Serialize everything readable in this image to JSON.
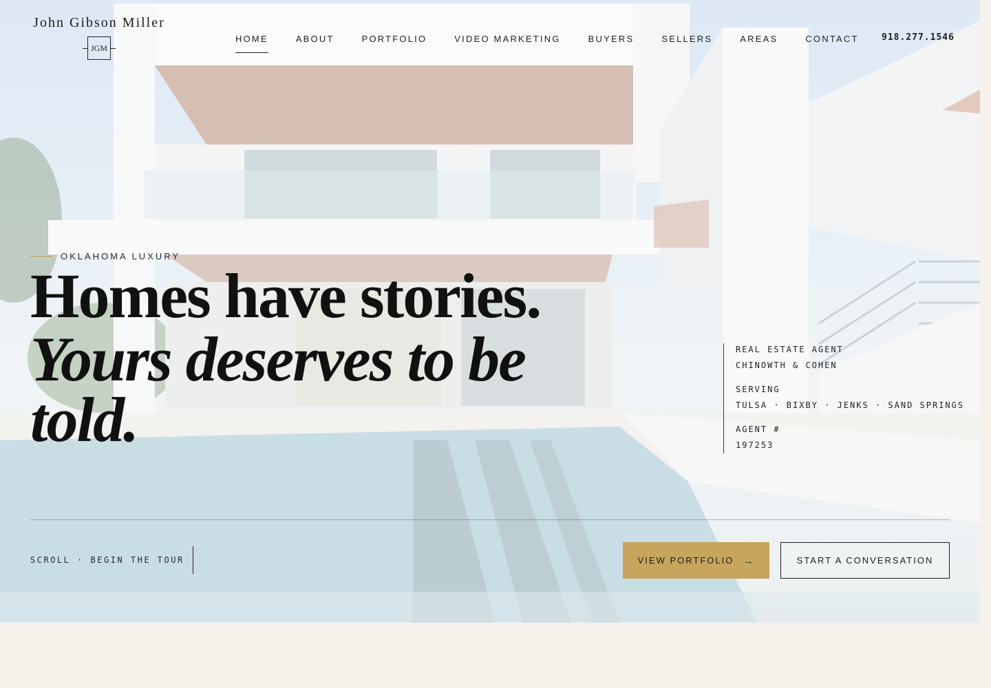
{
  "brand": {
    "name": "John Gibson Miller",
    "monogram": "JGM"
  },
  "nav": {
    "items": [
      {
        "label": "HOME",
        "active": true
      },
      {
        "label": "ABOUT",
        "active": false
      },
      {
        "label": "PORTFOLIO",
        "active": false
      },
      {
        "label": "VIDEO MARKETING",
        "active": false
      },
      {
        "label": "BUYERS",
        "active": false
      },
      {
        "label": "SELLERS",
        "active": false
      },
      {
        "label": "AREAS",
        "active": false
      },
      {
        "label": "CONTACT",
        "active": false
      }
    ],
    "phone": "918.277.1546"
  },
  "hero": {
    "eyebrow": "OKLAHOMA LUXURY",
    "headline_line1": "Homes have stories.",
    "headline_line2": "Yours deserves to be told."
  },
  "agent_info": {
    "role": "REAL ESTATE AGENT",
    "company": "CHINOWTH & COHEN",
    "serving_label": "SERVING",
    "serving_areas": "TULSA · BIXBY · JENKS · SAND SPRINGS",
    "agent_label": "AGENT #",
    "agent_number": "197253"
  },
  "footer_bar": {
    "scroll_text": "SCROLL · BEGIN THE TOUR",
    "primary_button": "VIEW PORTFOLIO",
    "primary_arrow": "→",
    "secondary_button": "START A CONVERSATION"
  },
  "colors": {
    "accent_gold": "#c7a55c",
    "page_bg": "#f6f1eb",
    "text_dark": "#111111"
  }
}
